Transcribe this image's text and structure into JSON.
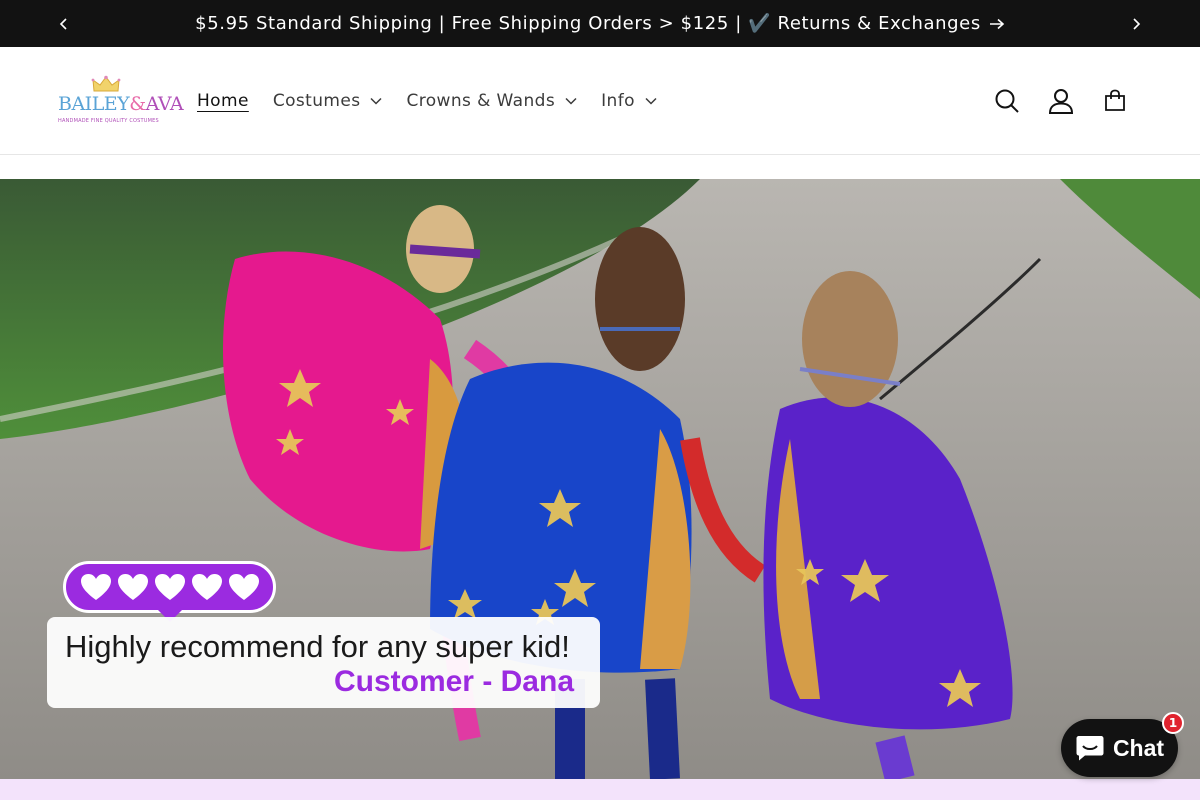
{
  "announcement": {
    "text": "$5.95 Standard Shipping | Free Shipping Orders > $125 | ✔️ Returns & Exchanges",
    "prev_icon": "chevron-left-icon",
    "next_icon": "chevron-right-icon",
    "link_icon": "arrow-right-icon"
  },
  "header": {
    "logo": {
      "text": "BAILEY&AVA",
      "tagline": "HANDMADE FINE QUALITY COSTUMES",
      "icon": "crown-icon"
    },
    "nav": [
      {
        "label": "Home",
        "active": true,
        "has_dropdown": false
      },
      {
        "label": "Costumes",
        "active": false,
        "has_dropdown": true
      },
      {
        "label": "Crowns & Wands",
        "active": false,
        "has_dropdown": true
      },
      {
        "label": "Info",
        "active": false,
        "has_dropdown": true
      }
    ],
    "icons": [
      "search-icon",
      "account-icon",
      "cart-icon"
    ]
  },
  "hero": {
    "hearts_count": 5,
    "testimonial": "Highly recommend for any super kid!",
    "author": "Customer - Dana"
  },
  "chat": {
    "label": "Chat",
    "badge": "1",
    "icon": "chat-bubble-icon"
  },
  "colors": {
    "announcement_bg": "#121212",
    "accent_purple": "#9b2be0",
    "badge_red": "#e0232e",
    "bottom_strip": "#f3e3fb"
  }
}
